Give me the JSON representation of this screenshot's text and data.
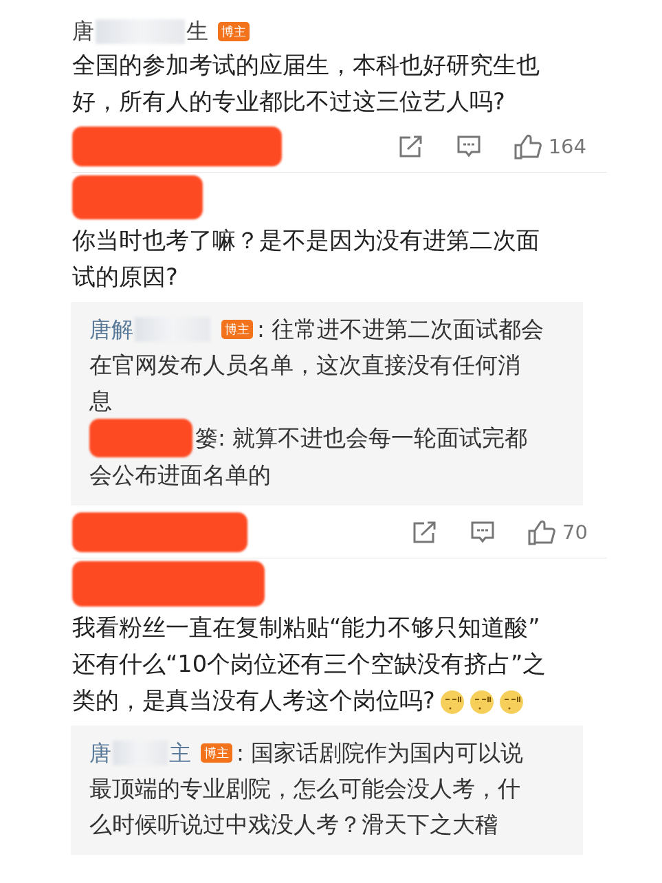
{
  "comments": [
    {
      "author": {
        "parts": [
          "唐",
          "生"
        ],
        "badge": "博主"
      },
      "lines": [
        "全国的参加考试的应届生，本科也好研究生也",
        "好，所有人的专业都比不过这三位艺人吗?"
      ],
      "footer": {
        "redacted": true,
        "likes": "164"
      }
    },
    {
      "author_redacted": true,
      "lines": [
        "你当时也考了嘛？是不是因为没有进第二次面",
        "试的原因?"
      ],
      "replies": [
        {
          "author": {
            "parts": [
              "唐解"
            ],
            "badge": "博主"
          },
          "lines": [
            ": 往常进不进第二次面试都会",
            "在官网发布人员名单，这次直接没有任何消",
            "息"
          ]
        },
        {
          "author_redacted": true,
          "lines": [
            "篓: 就算不进也会每一轮面试完都",
            "会公布进面名单的"
          ]
        }
      ],
      "footer": {
        "redacted": true,
        "likes": "70"
      }
    },
    {
      "author_redacted": true,
      "lines": [
        "我看粉丝一直在复制粘贴“能力不够只知道酸”",
        "还有什么“10个岗位还有三个空缺没有挤占”之",
        "类的，是真当没有人考这个岗位吗?"
      ],
      "emojis": [
        {
          "kind": "sweat-face"
        },
        {
          "kind": "sweat-face"
        },
        {
          "kind": "sweat-face"
        }
      ],
      "replies": [
        {
          "author": {
            "parts": [
              "唐",
              "主"
            ],
            "badge": "博主"
          },
          "lines": [
            ": 国家话剧院作为国内可以说",
            "最顶端的专业剧院，怎么可能会没人考，什",
            "么时候听说过中戏没人考？滑天下之大稽"
          ]
        }
      ]
    }
  ]
}
